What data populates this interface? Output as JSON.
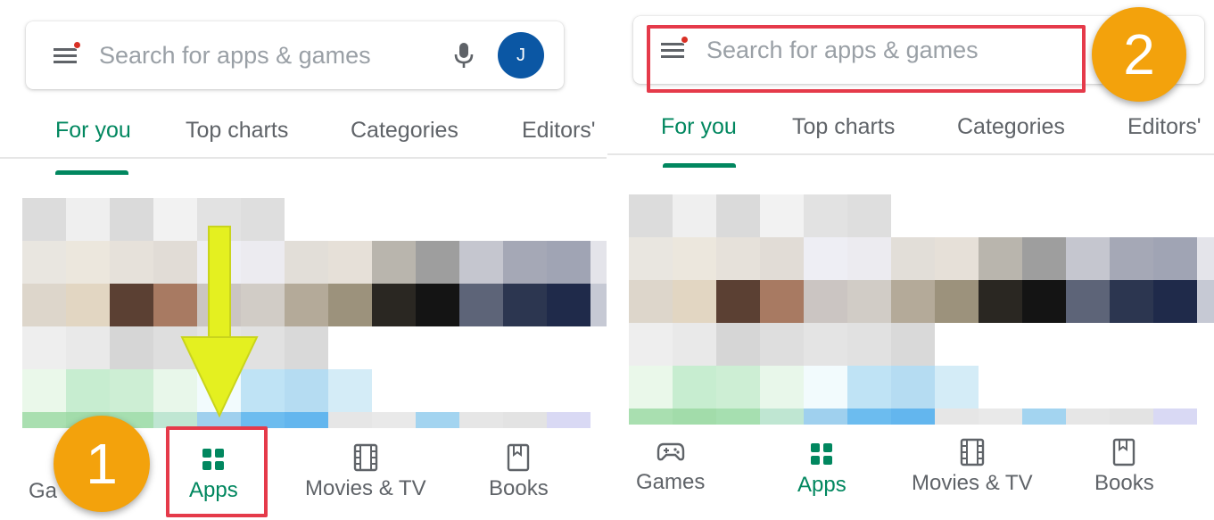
{
  "search": {
    "placeholder": "Search for apps & games",
    "avatar_letter": "J"
  },
  "tabs": [
    {
      "label": "For you",
      "active": true
    },
    {
      "label": "Top charts",
      "active": false
    },
    {
      "label": "Categories",
      "active": false
    },
    {
      "label": "Editors'",
      "active": false
    }
  ],
  "bottom_nav": [
    {
      "label": "Games",
      "icon": "gamepad-icon",
      "active": false
    },
    {
      "label": "Apps",
      "icon": "apps-grid-icon",
      "active": true
    },
    {
      "label": "Movies & TV",
      "icon": "film-icon",
      "active": false
    },
    {
      "label": "Books",
      "icon": "bookmark-book-icon",
      "active": false
    }
  ],
  "panel1": {
    "games_label_partial": "Ga",
    "step_number": "1"
  },
  "panel2": {
    "step_number": "2"
  },
  "colors": {
    "accent": "#01875f",
    "highlight": "#e53a4a",
    "badge": "#f3a20c",
    "arrow": "#e4f020",
    "avatar": "#0b57a4"
  },
  "mosaic_rows": [
    [
      "#dcdcdc",
      "#efefef",
      "#dadada",
      "#f2f2f2",
      "#e2e2e2",
      "#dedede"
    ],
    [
      "#e9e6e0",
      "#ece7dd",
      "#e6e1da",
      "#e1dcd6",
      "#eeeef4",
      "#ecebf0",
      "#e2ded8",
      "#e6e0d8",
      "#b9b5ad",
      "#9e9e9e",
      "#c5c6cf",
      "#a5a8b6",
      "#a0a4b4",
      "#e4e4ea"
    ],
    [
      "#ddd6cb",
      "#e2d6c2",
      "#5b4033",
      "#a87a62",
      "#cbc5c2",
      "#d1ccc6",
      "#b4aa99",
      "#9c927c",
      "#2a2722",
      "#141414",
      "#5d6478",
      "#2c3650",
      "#1f2a4a",
      "#c6c9d4"
    ],
    [
      "#eeeeee",
      "#e9e9e9",
      "#d6d6d6",
      "#dedede",
      "#e4e4e4",
      "#e1e1e1",
      "#d9d9d9"
    ],
    [
      "#eaf8ea",
      "#c7edd0",
      "#cdeed4",
      "#e8f7ea",
      "#f2fbfd",
      "#bfe3f5",
      "#b5dcf2",
      "#d4ecf7"
    ],
    [
      "#a9dfb0",
      "#a2dcaa",
      "#a6dfb0",
      "#bfe6d2",
      "#9fd0ee",
      "#6cbcef",
      "#63b6ee",
      "#e6e6e6",
      "#e9e9e9",
      "#a3d4f0",
      "#e6e6e6",
      "#e3e3e3",
      "#d9d9f4",
      "#ffffff"
    ]
  ]
}
